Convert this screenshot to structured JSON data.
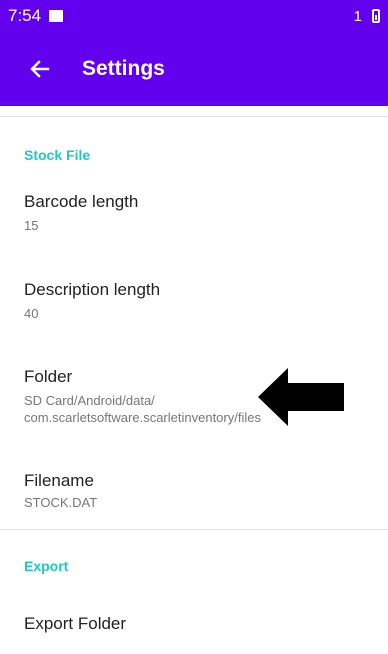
{
  "status_bar": {
    "time": "7:54",
    "notification_count": "1"
  },
  "toolbar": {
    "title": "Settings",
    "back_icon": "arrow-back-icon"
  },
  "sections": {
    "stock_file": {
      "header": "Stock File",
      "barcode_length": {
        "title": "Barcode length",
        "value": "15"
      },
      "description_length": {
        "title": "Description length",
        "value": "40"
      },
      "folder": {
        "title": "Folder",
        "line1": "SD Card/Android/data/",
        "line2": "com.scarletsoftware.scarletinventory/files"
      },
      "filename": {
        "title": "Filename",
        "value": "STOCK.DAT"
      }
    },
    "export": {
      "header": "Export",
      "export_folder": {
        "title": "Export Folder"
      }
    }
  },
  "colors": {
    "accent": "#6200ee",
    "category": "#1ec8c8"
  }
}
